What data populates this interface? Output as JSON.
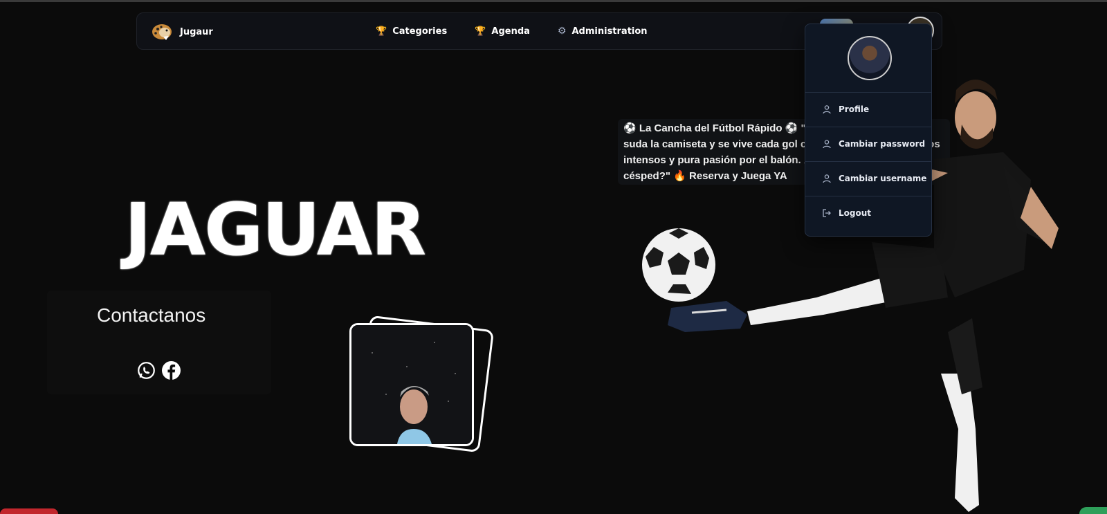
{
  "navbar": {
    "brand": "Jugaur",
    "links": [
      {
        "label": "Categories",
        "icon": "trophy-icon"
      },
      {
        "label": "Agenda",
        "icon": "trophy-icon"
      },
      {
        "label": "Administration",
        "icon": "gear-icon"
      }
    ]
  },
  "user_menu": {
    "items": [
      {
        "label": "Profile",
        "icon": "user-icon"
      },
      {
        "label": "Cambiar password",
        "icon": "user-icon"
      },
      {
        "label": "Cambiar username",
        "icon": "user-icon"
      },
      {
        "label": "Logout",
        "icon": "logout-icon"
      }
    ]
  },
  "hero": {
    "title": "JAGUAR",
    "contact_title": "Contactanos",
    "social": [
      "whatsapp-icon",
      "facebook-icon"
    ]
  },
  "quote": {
    "text": "⚽ La Cancha del Fútbol Rápido ⚽ \"Aquí se juega rápido, se suda la camiseta y se vive cada gol con jugadas ágiles, partidos intensos y pura pasión por el balón. ¿Listo para pisar el césped?\" 🔥 Reserva y Juega YA"
  },
  "colors": {
    "background": "#0b0b0b",
    "navbar": "#0f1116",
    "dropdown": "#0f1724",
    "trophy": "#e9a23b"
  }
}
